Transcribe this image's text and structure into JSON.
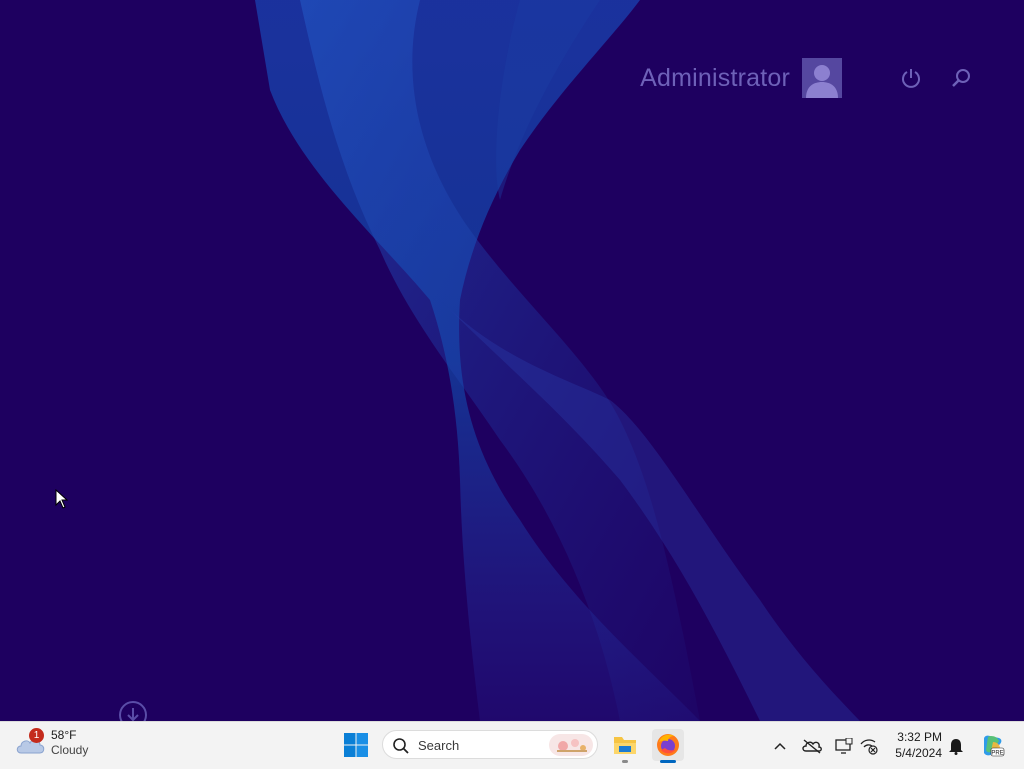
{
  "lock_screen": {
    "user_name": "Administrator"
  },
  "taskbar": {
    "weather": {
      "temperature": "58°F",
      "condition": "Cloudy",
      "badge_count": "1"
    },
    "search": {
      "placeholder": "Search"
    },
    "clock": {
      "time": "3:32 PM",
      "date": "5/4/2024"
    }
  },
  "colors": {
    "desktop_background": "#1e0060",
    "accent_blue": "#0067c0",
    "user_text": "#6e61b8"
  }
}
